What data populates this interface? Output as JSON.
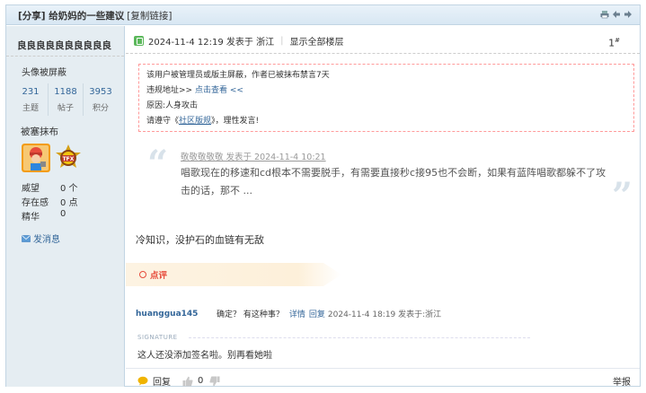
{
  "header": {
    "title": "[分享] 给奶妈的一些建议",
    "copy_link": "[复制链接]",
    "tool_icons": [
      "print-icon",
      "prev-thread-icon",
      "next-thread-icon"
    ]
  },
  "author": {
    "name": "良良良良良良良良良良",
    "avatar_text": "头像被屏蔽",
    "stats": [
      {
        "value": "231",
        "label": "主题"
      },
      {
        "value": "1188",
        "label": "帖子"
      },
      {
        "value": "3953",
        "label": "积分"
      }
    ],
    "status": "被塞抹布",
    "info": [
      {
        "key": "威望",
        "value": "0 个"
      },
      {
        "key": "存在感",
        "value": "0 点"
      },
      {
        "key": "精华",
        "value": "0"
      }
    ],
    "pm_label": "发消息"
  },
  "post": {
    "posted_at": "2024-11-4 12:19 发表于 浙江",
    "show_all": "显示全部楼层",
    "floor": "1",
    "floor_suffix": "#",
    "notice": {
      "line1": "该用户被管理员或版主屏蔽，作者已被抹布禁言7天",
      "line2_prefix": "违规地址>> ",
      "line2_link": "点击查看 <<",
      "line3": "原因:人身攻击",
      "line4_prefix": "请遵守《",
      "line4_link": "社区版规",
      "line4_suffix": "》，理性发言!"
    },
    "quote": {
      "head": "敬敬敬敬敬 发表于 2024-11-4 10:21",
      "text": "唱歌现在的移速和cd根本不需要脱手，有需要直接秒c接95也不会断，如果有蓝阵唱歌都躲不了攻击的话，那不 ..."
    },
    "body": "冷知识，没护石的血链有无敌",
    "rate_label": "点评",
    "reply": {
      "user": "huanggua145",
      "text": "确定？ 有这种事？",
      "detail": "详情",
      "reply_link": "回复",
      "date": "2024-11-4 18:19 发表于:浙江"
    },
    "signature_label": "SIGNATURE",
    "signature": "这人还没添加签名啦。别再看她啦",
    "actions": {
      "reply": "回复",
      "likes": "0",
      "dislikes": "0"
    },
    "report": "举报"
  },
  "colors": {
    "link": "#336699",
    "rate": "#e74c3c",
    "sidebar_bg": "#e5edf2"
  }
}
